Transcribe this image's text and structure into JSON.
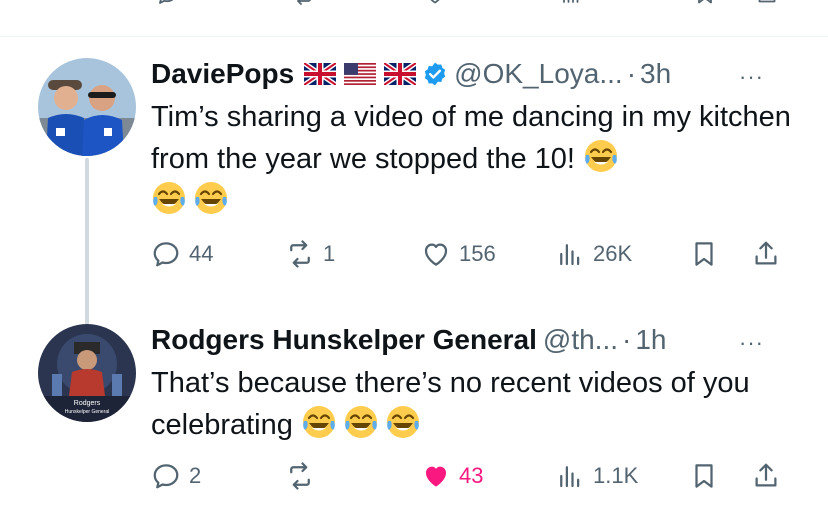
{
  "colors": {
    "text_primary": "#0f1419",
    "text_secondary": "#536471",
    "verified_blue": "#1d9bf0",
    "like_pink": "#f91880",
    "thread_line": "#cfd9de"
  },
  "tweets": [
    {
      "display_name": "DaviePops",
      "flags": [
        "uk-flag-icon",
        "us-flag-icon",
        "uk-flag-icon"
      ],
      "verified": true,
      "handle": "@OK_Loya...",
      "separator": "·",
      "time": "3h",
      "more": "···",
      "text": "Tim’s sharing a video of me dancing in my kitchen from the year we stopped the 10!",
      "emojis": [
        "laughing-tears-emoji",
        "laughing-tears-emoji",
        "laughing-tears-emoji"
      ],
      "replies": "44",
      "retweets": "1",
      "likes": "156",
      "views": "26K",
      "liked": false
    },
    {
      "display_name": "Rodgers Hunskelper General",
      "handle": "@th...",
      "separator": "·",
      "time": "1h",
      "more": "···",
      "text": "That’s because there’s no recent videos of you celebrating",
      "avatar_text": "Rodgers Hunskelper General",
      "emojis": [
        "laughing-tears-emoji",
        "laughing-tears-emoji",
        "laughing-tears-emoji"
      ],
      "replies": "2",
      "retweets": "",
      "likes": "43",
      "views": "1.1K",
      "liked": true
    }
  ]
}
